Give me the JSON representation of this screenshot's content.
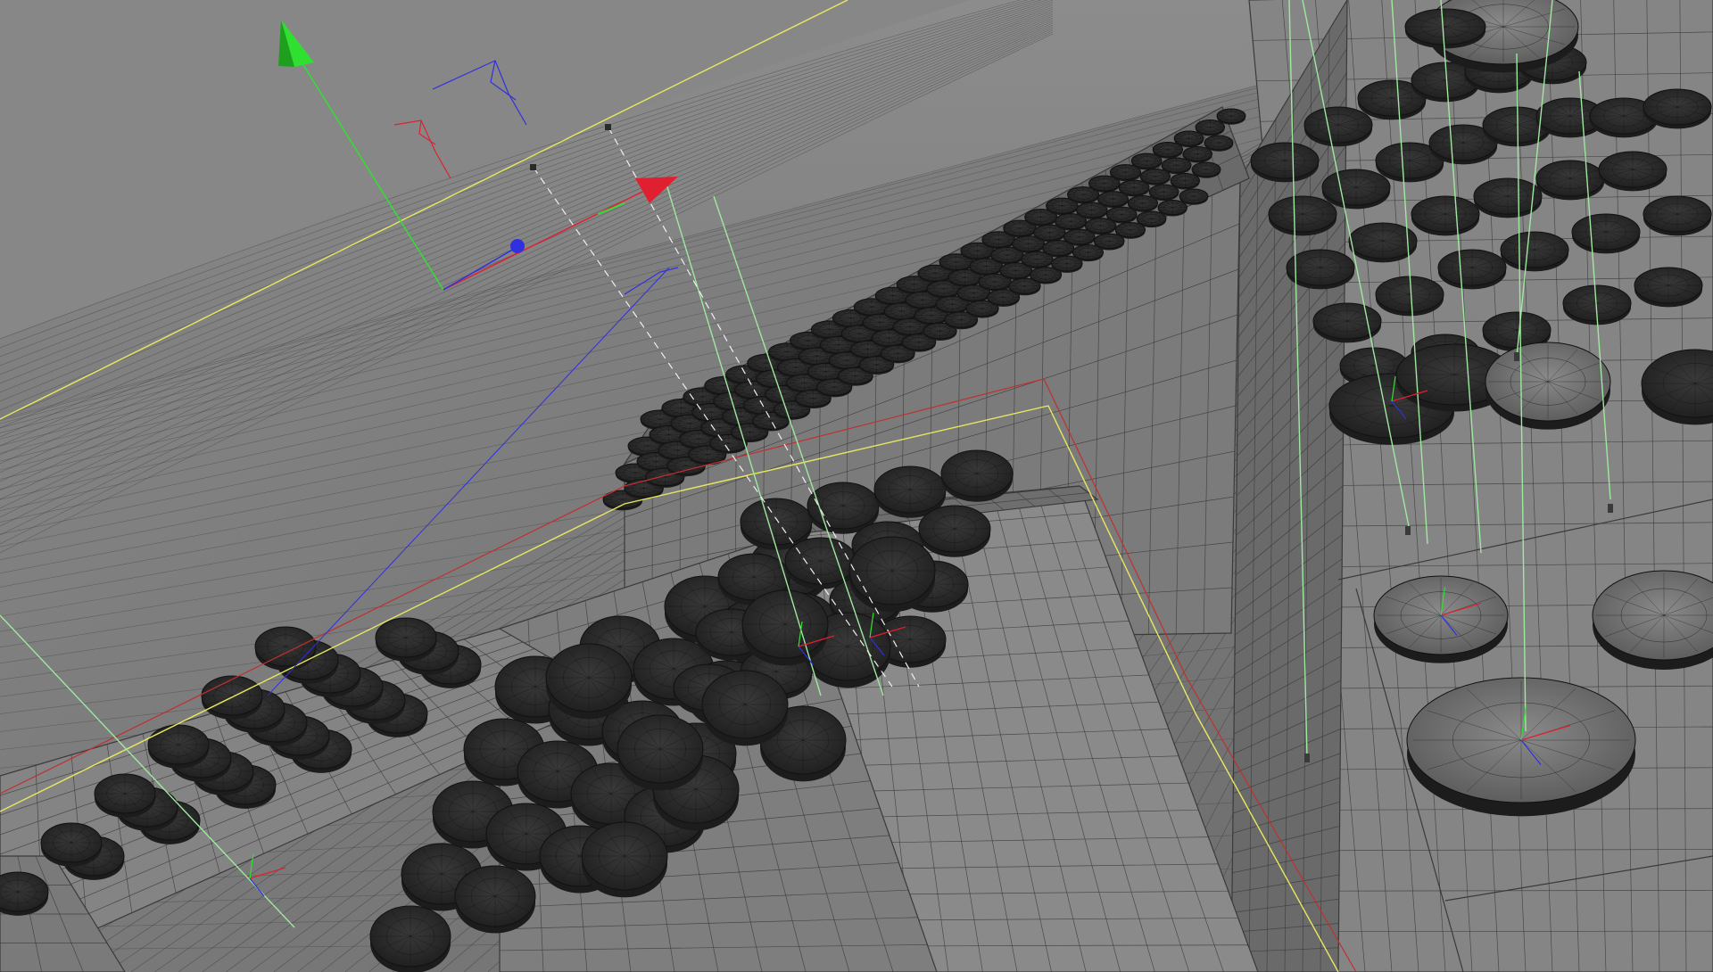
{
  "app": {
    "view_type": "3D perspective viewport",
    "display_mode": "wireframe-on-shaded"
  },
  "colors": {
    "background_top": "#8a8a8a",
    "background_bottom": "#6e6e6e",
    "surface_light": "#8e8e8e",
    "surface_mid": "#7b7b7b",
    "surface_dark": "#5f5f5f",
    "wire": "#3a3a3a",
    "disc_fill": "#2c2c2c",
    "disc_rim": "#1c1c1c",
    "axis_x": "#e02030",
    "axis_y": "#30e030",
    "axis_z": "#3030e0",
    "light_line": "#e8e860",
    "guide_line": "#9fe89f",
    "selection_red": "#c03030"
  },
  "gizmo": {
    "icons": [
      "move-gizmo-icon",
      "x-axis-arrow-icon",
      "y-axis-arrow-icon",
      "z-axis-handle-icon"
    ]
  }
}
